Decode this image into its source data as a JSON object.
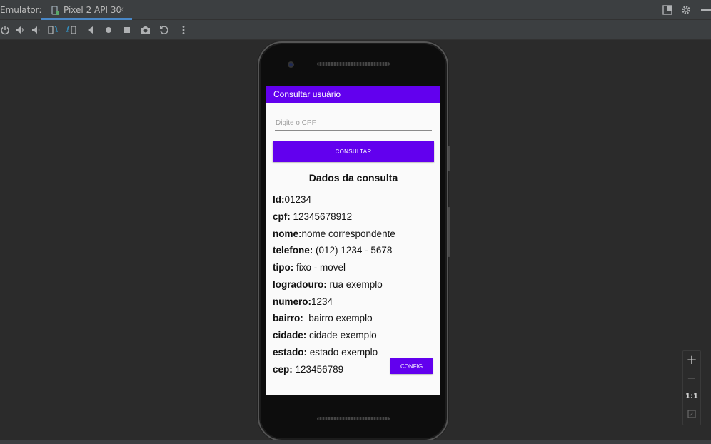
{
  "ide": {
    "emulator_label": "Emulator:",
    "tab_title": "Pixel 2 API 30",
    "tab_close": "×",
    "toolbar_icons": [
      "power-icon",
      "volume-up-icon",
      "volume-down-icon",
      "rotate-left-icon",
      "rotate-right-icon",
      "back-icon",
      "home-icon",
      "overview-icon",
      "camera-icon",
      "reset-icon",
      "more-icon"
    ],
    "zoom": {
      "zoom_in": "+",
      "zoom_out": "−",
      "actual_size": "1:1"
    }
  },
  "app": {
    "title": "Consultar usuário",
    "cpf_placeholder": "Digite o CPF",
    "consultar_label": "CONSULTAR",
    "section_title": "Dados da consulta",
    "fields": [
      {
        "key": "Id:",
        "value": "01234"
      },
      {
        "key": "cpf:",
        "value": "12345678912"
      },
      {
        "key": "nome:",
        "value": "nome correspondente"
      },
      {
        "key": "telefone:",
        "value": "(012) 1234 - 5678"
      },
      {
        "key": "tipo:",
        "value": "fixo - movel"
      },
      {
        "key": "logradouro:",
        "value": "rua exemplo"
      },
      {
        "key": "numero:",
        "value": "1234"
      },
      {
        "key": "bairro:",
        "value": " bairro exemplo"
      },
      {
        "key": "cidade:",
        "value": "cidade exemplo"
      },
      {
        "key": "estado:",
        "value": "estado exemplo"
      },
      {
        "key": "cep:",
        "value": "123456789"
      }
    ],
    "config_label": "CONFIG"
  },
  "colors": {
    "accent": "#6200ee",
    "ide_background": "#2b2b2b",
    "ide_panel": "#3c3f41",
    "tab_underline": "#4a88c7"
  }
}
